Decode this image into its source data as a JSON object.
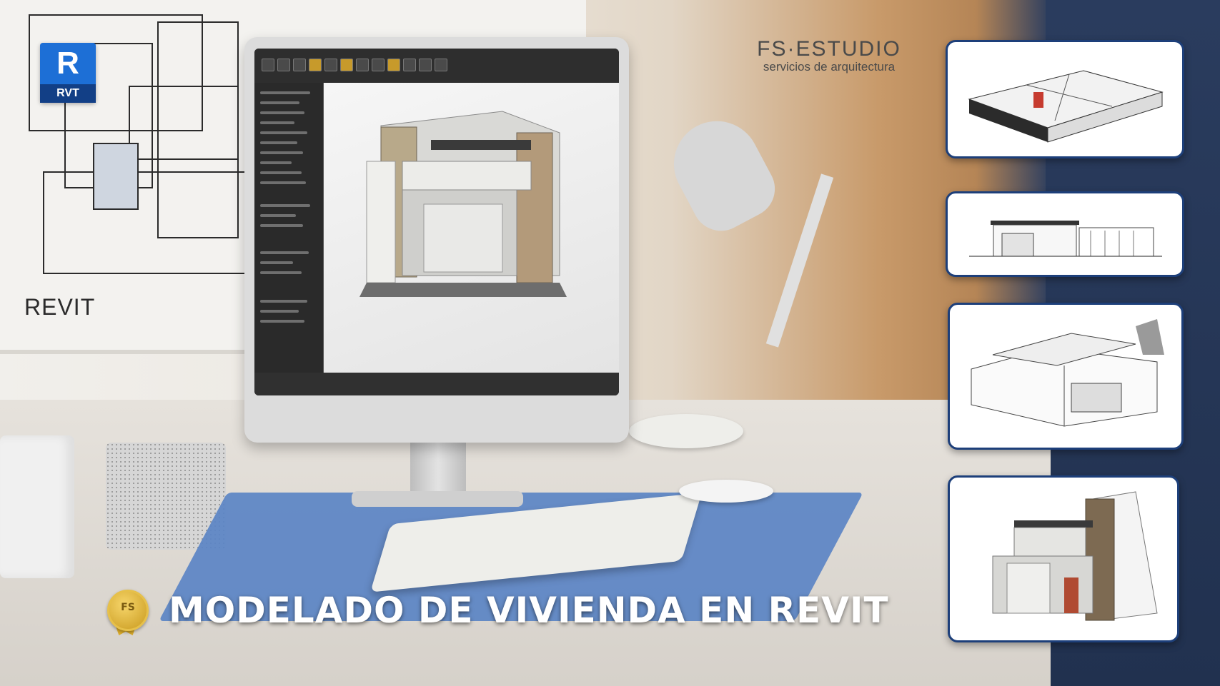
{
  "logo": {
    "letter": "R",
    "tag": "RVT"
  },
  "wall_label": "REVIT",
  "brand": {
    "name": "FS·ESTUDIO",
    "tagline": "servicios de arquitectura"
  },
  "seal": {
    "text": "FS"
  },
  "title": "MODELADO DE VIVIENDA EN REVIT",
  "thumbnails": [
    {
      "view": "3D floor plan section"
    },
    {
      "view": "front elevation"
    },
    {
      "view": "3D axonometric line view"
    },
    {
      "view": "3D rendered facade"
    }
  ],
  "colors": {
    "accent": "#1d6fd6",
    "thumbnail_border": "#1d3f7a",
    "right_panel": "#27375a",
    "title": "#ffffff"
  }
}
